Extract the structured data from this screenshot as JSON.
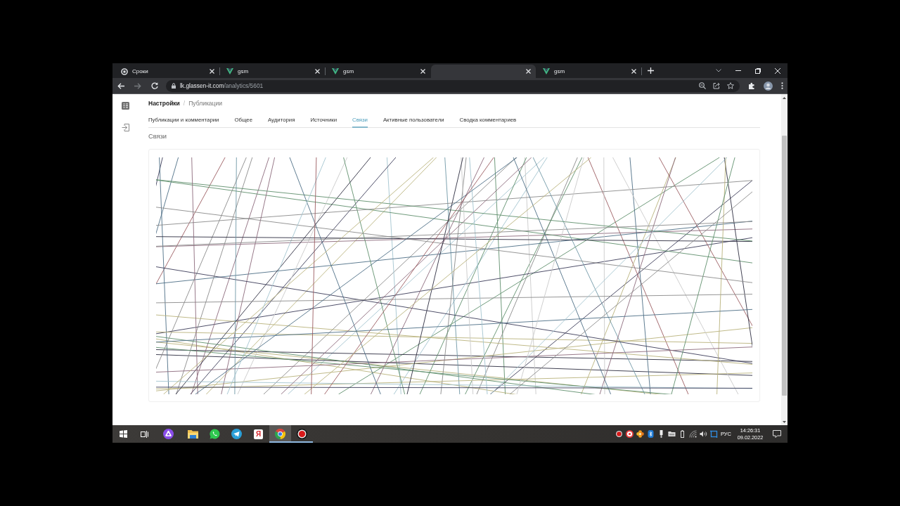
{
  "browser": {
    "tabs": [
      {
        "title": "Сроки",
        "kind": "ring",
        "selected": false
      },
      {
        "title": "gsm",
        "kind": "chevron",
        "selected": false
      },
      {
        "title": "gsm",
        "kind": "chevron",
        "selected": false
      },
      {
        "selected": true
      },
      {
        "title": "gsm",
        "kind": "chevron",
        "selected": false
      }
    ],
    "address": {
      "host": "lk.glassen-it.com",
      "path": "/analytics/5601"
    }
  },
  "page": {
    "breadcrumb": {
      "items": [
        "Настройки",
        "Публикации"
      ],
      "separator": "/"
    },
    "tabs": [
      {
        "label": "Публикации и комментарии",
        "selected": false
      },
      {
        "label": "Общее",
        "selected": false
      },
      {
        "label": "Аудитория",
        "selected": false
      },
      {
        "label": "Источники",
        "selected": false
      },
      {
        "label": "Связи",
        "selected": true
      },
      {
        "label": "Активные пользователи",
        "selected": false
      },
      {
        "label": "Сводка комментариев",
        "selected": false
      }
    ],
    "section_title": "Связи"
  },
  "taskbar": {
    "apps": [
      {
        "kind": "assistant",
        "running": false,
        "selected": false
      },
      {
        "kind": "folder",
        "running": false,
        "selected": false
      },
      {
        "kind": "chat",
        "running": false,
        "selected": false
      },
      {
        "kind": "plane",
        "running": false,
        "selected": false
      },
      {
        "kind": "letter",
        "label": "Я",
        "running": false,
        "selected": false
      },
      {
        "kind": "browser",
        "running": true,
        "selected": true
      },
      {
        "kind": "record",
        "running": true,
        "selected": false
      }
    ],
    "language": "РУС",
    "time": "14:26:31",
    "date": "09.02.2022"
  }
}
